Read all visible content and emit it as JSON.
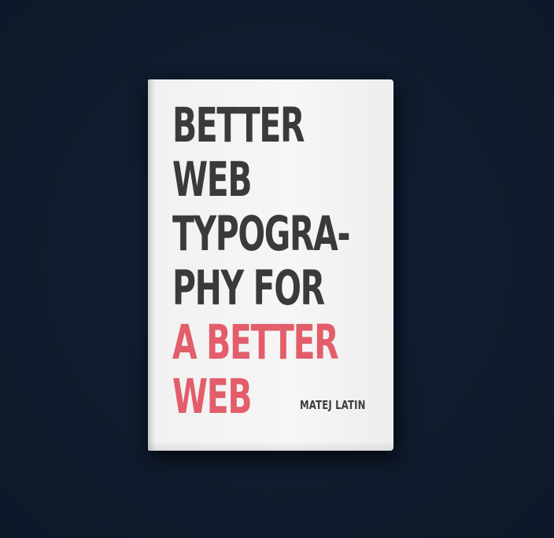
{
  "book": {
    "title_lines": [
      "BETTER",
      "WEB",
      "TYPOGRA-",
      "PHY FOR",
      "A BETTER",
      "WEB"
    ],
    "author": "MATEJ LATIN"
  },
  "colors": {
    "background": "#101b2d",
    "cover": "#f3f3f3",
    "title_dark": "#3a3a3a",
    "title_accent": "#e35d6a",
    "author": "#3d3d3d"
  }
}
